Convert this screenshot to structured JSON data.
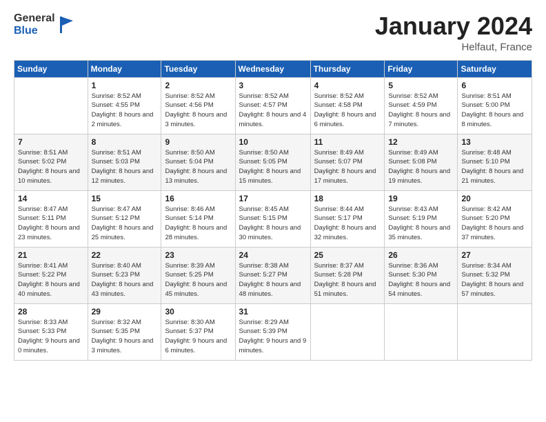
{
  "logo": {
    "general": "General",
    "blue": "Blue"
  },
  "title": {
    "month": "January 2024",
    "location": "Helfaut, France"
  },
  "headers": [
    "Sunday",
    "Monday",
    "Tuesday",
    "Wednesday",
    "Thursday",
    "Friday",
    "Saturday"
  ],
  "weeks": [
    [
      {
        "day": "",
        "sunrise": "",
        "sunset": "",
        "daylight": ""
      },
      {
        "day": "1",
        "sunrise": "Sunrise: 8:52 AM",
        "sunset": "Sunset: 4:55 PM",
        "daylight": "Daylight: 8 hours and 2 minutes."
      },
      {
        "day": "2",
        "sunrise": "Sunrise: 8:52 AM",
        "sunset": "Sunset: 4:56 PM",
        "daylight": "Daylight: 8 hours and 3 minutes."
      },
      {
        "day": "3",
        "sunrise": "Sunrise: 8:52 AM",
        "sunset": "Sunset: 4:57 PM",
        "daylight": "Daylight: 8 hours and 4 minutes."
      },
      {
        "day": "4",
        "sunrise": "Sunrise: 8:52 AM",
        "sunset": "Sunset: 4:58 PM",
        "daylight": "Daylight: 8 hours and 6 minutes."
      },
      {
        "day": "5",
        "sunrise": "Sunrise: 8:52 AM",
        "sunset": "Sunset: 4:59 PM",
        "daylight": "Daylight: 8 hours and 7 minutes."
      },
      {
        "day": "6",
        "sunrise": "Sunrise: 8:51 AM",
        "sunset": "Sunset: 5:00 PM",
        "daylight": "Daylight: 8 hours and 8 minutes."
      }
    ],
    [
      {
        "day": "7",
        "sunrise": "Sunrise: 8:51 AM",
        "sunset": "Sunset: 5:02 PM",
        "daylight": "Daylight: 8 hours and 10 minutes."
      },
      {
        "day": "8",
        "sunrise": "Sunrise: 8:51 AM",
        "sunset": "Sunset: 5:03 PM",
        "daylight": "Daylight: 8 hours and 12 minutes."
      },
      {
        "day": "9",
        "sunrise": "Sunrise: 8:50 AM",
        "sunset": "Sunset: 5:04 PM",
        "daylight": "Daylight: 8 hours and 13 minutes."
      },
      {
        "day": "10",
        "sunrise": "Sunrise: 8:50 AM",
        "sunset": "Sunset: 5:05 PM",
        "daylight": "Daylight: 8 hours and 15 minutes."
      },
      {
        "day": "11",
        "sunrise": "Sunrise: 8:49 AM",
        "sunset": "Sunset: 5:07 PM",
        "daylight": "Daylight: 8 hours and 17 minutes."
      },
      {
        "day": "12",
        "sunrise": "Sunrise: 8:49 AM",
        "sunset": "Sunset: 5:08 PM",
        "daylight": "Daylight: 8 hours and 19 minutes."
      },
      {
        "day": "13",
        "sunrise": "Sunrise: 8:48 AM",
        "sunset": "Sunset: 5:10 PM",
        "daylight": "Daylight: 8 hours and 21 minutes."
      }
    ],
    [
      {
        "day": "14",
        "sunrise": "Sunrise: 8:47 AM",
        "sunset": "Sunset: 5:11 PM",
        "daylight": "Daylight: 8 hours and 23 minutes."
      },
      {
        "day": "15",
        "sunrise": "Sunrise: 8:47 AM",
        "sunset": "Sunset: 5:12 PM",
        "daylight": "Daylight: 8 hours and 25 minutes."
      },
      {
        "day": "16",
        "sunrise": "Sunrise: 8:46 AM",
        "sunset": "Sunset: 5:14 PM",
        "daylight": "Daylight: 8 hours and 28 minutes."
      },
      {
        "day": "17",
        "sunrise": "Sunrise: 8:45 AM",
        "sunset": "Sunset: 5:15 PM",
        "daylight": "Daylight: 8 hours and 30 minutes."
      },
      {
        "day": "18",
        "sunrise": "Sunrise: 8:44 AM",
        "sunset": "Sunset: 5:17 PM",
        "daylight": "Daylight: 8 hours and 32 minutes."
      },
      {
        "day": "19",
        "sunrise": "Sunrise: 8:43 AM",
        "sunset": "Sunset: 5:19 PM",
        "daylight": "Daylight: 8 hours and 35 minutes."
      },
      {
        "day": "20",
        "sunrise": "Sunrise: 8:42 AM",
        "sunset": "Sunset: 5:20 PM",
        "daylight": "Daylight: 8 hours and 37 minutes."
      }
    ],
    [
      {
        "day": "21",
        "sunrise": "Sunrise: 8:41 AM",
        "sunset": "Sunset: 5:22 PM",
        "daylight": "Daylight: 8 hours and 40 minutes."
      },
      {
        "day": "22",
        "sunrise": "Sunrise: 8:40 AM",
        "sunset": "Sunset: 5:23 PM",
        "daylight": "Daylight: 8 hours and 43 minutes."
      },
      {
        "day": "23",
        "sunrise": "Sunrise: 8:39 AM",
        "sunset": "Sunset: 5:25 PM",
        "daylight": "Daylight: 8 hours and 45 minutes."
      },
      {
        "day": "24",
        "sunrise": "Sunrise: 8:38 AM",
        "sunset": "Sunset: 5:27 PM",
        "daylight": "Daylight: 8 hours and 48 minutes."
      },
      {
        "day": "25",
        "sunrise": "Sunrise: 8:37 AM",
        "sunset": "Sunset: 5:28 PM",
        "daylight": "Daylight: 8 hours and 51 minutes."
      },
      {
        "day": "26",
        "sunrise": "Sunrise: 8:36 AM",
        "sunset": "Sunset: 5:30 PM",
        "daylight": "Daylight: 8 hours and 54 minutes."
      },
      {
        "day": "27",
        "sunrise": "Sunrise: 8:34 AM",
        "sunset": "Sunset: 5:32 PM",
        "daylight": "Daylight: 8 hours and 57 minutes."
      }
    ],
    [
      {
        "day": "28",
        "sunrise": "Sunrise: 8:33 AM",
        "sunset": "Sunset: 5:33 PM",
        "daylight": "Daylight: 9 hours and 0 minutes."
      },
      {
        "day": "29",
        "sunrise": "Sunrise: 8:32 AM",
        "sunset": "Sunset: 5:35 PM",
        "daylight": "Daylight: 9 hours and 3 minutes."
      },
      {
        "day": "30",
        "sunrise": "Sunrise: 8:30 AM",
        "sunset": "Sunset: 5:37 PM",
        "daylight": "Daylight: 9 hours and 6 minutes."
      },
      {
        "day": "31",
        "sunrise": "Sunrise: 8:29 AM",
        "sunset": "Sunset: 5:39 PM",
        "daylight": "Daylight: 9 hours and 9 minutes."
      },
      {
        "day": "",
        "sunrise": "",
        "sunset": "",
        "daylight": ""
      },
      {
        "day": "",
        "sunrise": "",
        "sunset": "",
        "daylight": ""
      },
      {
        "day": "",
        "sunrise": "",
        "sunset": "",
        "daylight": ""
      }
    ]
  ]
}
